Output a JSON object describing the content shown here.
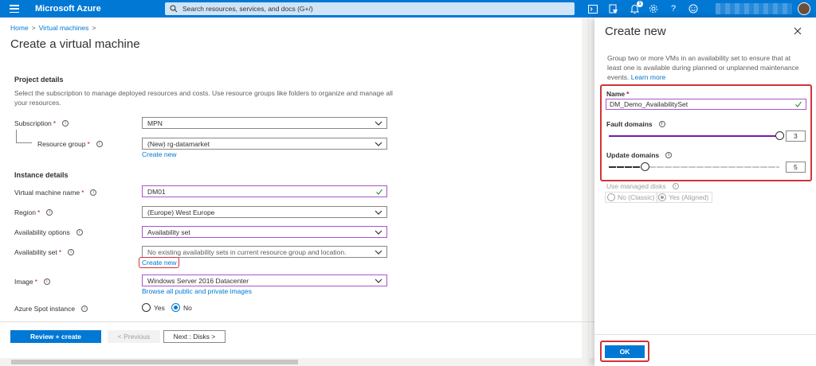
{
  "topbar": {
    "brand": "Microsoft Azure",
    "search_placeholder": "Search resources, services, and docs (G+/)",
    "notification_count": "1",
    "color": "#0078d4"
  },
  "breadcrumb": {
    "items": [
      "Home",
      "Virtual machines"
    ]
  },
  "page_title": "Create a virtual machine",
  "project": {
    "title": "Project details",
    "description": "Select the subscription to manage deployed resources and costs. Use resource groups like folders to organize and manage all your resources.",
    "subscription_label": "Subscription",
    "subscription_value": "MPN",
    "resource_group_label": "Resource group",
    "resource_group_value": "(New) rg-datamarket",
    "create_new": "Create new"
  },
  "instance": {
    "title": "Instance details",
    "vm_name_label": "Virtual machine name",
    "vm_name_value": "DM01",
    "region_label": "Region",
    "region_value": "(Europe) West Europe",
    "availability_options_label": "Availability options",
    "availability_options_value": "Availability set",
    "availability_set_label": "Availability set",
    "availability_set_placeholder": "No existing availability sets in current resource group and location.",
    "create_new": "Create new",
    "image_label": "Image",
    "image_value": "Windows Server 2016 Datacenter",
    "browse_images": "Browse all public and private images",
    "spot_label": "Azure Spot instance",
    "spot_yes": "Yes",
    "spot_no": "No"
  },
  "footer": {
    "review_create": "Review + create",
    "previous": "< Previous",
    "next": "Next : Disks >"
  },
  "panel": {
    "title": "Create new",
    "description": "Group two or more VMs in an availability set to ensure that at least one is available during planned or unplanned maintenance events.",
    "learn_more": "Learn more",
    "name_label": "Name",
    "name_value": "DM_Demo_AvailabilitySet",
    "fault_label": "Fault domains",
    "fault_value": "3",
    "fault_max": 3,
    "update_label": "Update domains",
    "update_value": "5",
    "update_max": 20,
    "managed_label": "Use managed disks",
    "managed_no": "No (Classic)",
    "managed_yes": "Yes (Aligned)",
    "ok": "OK",
    "accent": "#7719aa",
    "highlight": "#d13438"
  }
}
